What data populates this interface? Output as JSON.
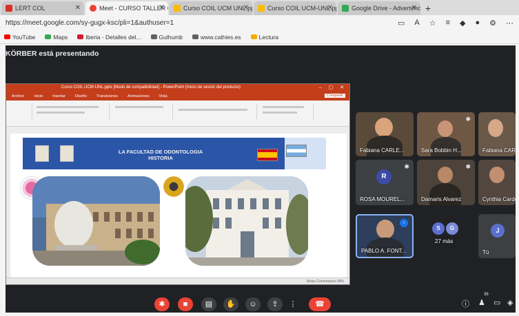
{
  "browser": {
    "tabs": [
      {
        "label": "LERT COL",
        "icon_color": "#d93025"
      },
      {
        "label": "Meet - CURSO TALLER COL",
        "icon_color": "#ea4335"
      },
      {
        "label": "Curso COIL UCM UNL.ppx - Goo",
        "icon_color": "#fbbc04"
      },
      {
        "label": "Curso COIL UCM-UNL.pptx - Go",
        "icon_color": "#fbbc04"
      },
      {
        "label": "Google Drive - Advertencia de c",
        "icon_color": "#34a853"
      }
    ],
    "new_tab": "+",
    "url": "https://meet.google.com/sy-gugx-ksc/pli=1&authuser=1",
    "toolbar_icons": [
      "cast-icon",
      "text-size-icon",
      "star-icon",
      "reading-list-icon",
      "extensions-icon",
      "profile-icon",
      "settings-icon",
      "menu-icon"
    ],
    "bookmarks": [
      {
        "label": "YouTube",
        "color": "#ff0000"
      },
      {
        "label": "Maps",
        "color": "#34a853"
      },
      {
        "label": "Iberia - Detalles del...",
        "color": "#d7192d"
      },
      {
        "label": "Gulhumb",
        "color": "#5f6368"
      },
      {
        "label": "www.cathies.es",
        "color": "#5f6368"
      },
      {
        "label": "Lectura",
        "color": "#f9ab00"
      }
    ]
  },
  "meet": {
    "presenting_text": "KÖRBER está presentando",
    "slide": {
      "window_title": "Curso COIL UCM-UNL.pptx [Modo de compatibilidad] - PowerPoint (Inicio de sesión del producto)",
      "menu": [
        "Archivo",
        "Inicio",
        "Insertar",
        "Diseño",
        "Transiciones",
        "Animaciones",
        "Vista"
      ],
      "share_label": "Compartir",
      "title": "LA FACULTAD DE ODONTOLOGIA\nHISTORIA",
      "status_text": "Notas  Comentarios  99%"
    },
    "participants": [
      {
        "name": "Fabiana CARLE...",
        "avatar_color": "#d47b3b"
      },
      {
        "name": "Sara Bobbin H...",
        "avatar_color": "#7a5a3c"
      },
      {
        "name": "Fabiana CARLE...",
        "avatar_color": "#caa07a"
      },
      {
        "name": "ROSA MOUREL...",
        "initial": "R",
        "avatar_color": "#3c4ba8"
      },
      {
        "name": "Damaris Alvarez",
        "avatar_color": "#6b584a"
      },
      {
        "name": "Cynthia Cardoz...",
        "avatar_color": "#8a7060"
      },
      {
        "name": "PABLO A. FONT...",
        "avatar_color": "#4a6fa5"
      },
      {
        "name": "27 más",
        "initials": [
          "S",
          "G"
        ],
        "avatar_color": "#5b6fcf"
      },
      {
        "name": "Tú",
        "initial": "J",
        "avatar_color": "#5b6fcf"
      }
    ],
    "controls": {
      "main": [
        "mic-off-icon",
        "camera-off-icon",
        "captions-icon",
        "raise-hand-icon",
        "emoji-icon",
        "present-icon",
        "more-icon",
        "end-call-icon"
      ],
      "side": [
        "info-icon",
        "people-icon",
        "chat-icon",
        "activities-icon"
      ],
      "people_count": "36"
    }
  }
}
